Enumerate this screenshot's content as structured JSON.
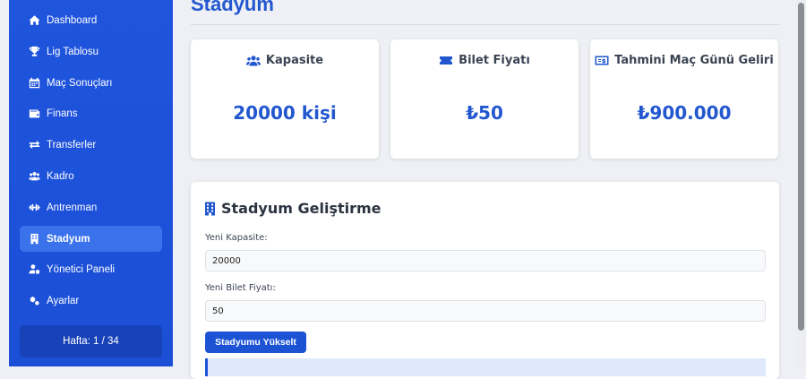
{
  "sidebar": {
    "items": [
      {
        "label": "Dashboard",
        "icon": "home-icon"
      },
      {
        "label": "Lig Tablosu",
        "icon": "trophy-icon"
      },
      {
        "label": "Maç Sonuçları",
        "icon": "calendar-icon"
      },
      {
        "label": "Finans",
        "icon": "wallet-icon"
      },
      {
        "label": "Transferler",
        "icon": "exchange-icon"
      },
      {
        "label": "Kadro",
        "icon": "users-icon"
      },
      {
        "label": "Antrenman",
        "icon": "dumbbell-icon"
      },
      {
        "label": "Stadyum",
        "icon": "building-icon",
        "active": true
      },
      {
        "label": "Yönetici Paneli",
        "icon": "user-cog-icon"
      },
      {
        "label": "Ayarlar",
        "icon": "gears-icon"
      }
    ],
    "week": "Hafta: 1 / 34"
  },
  "page": {
    "title": "Stadyum"
  },
  "cards": [
    {
      "title": "Kapasite",
      "value": "20000 kişi",
      "icon": "users-icon"
    },
    {
      "title": "Bilet Fiyatı",
      "value": "₺50",
      "icon": "ticket-icon"
    },
    {
      "title": "Tahmini Maç Günü Geliri",
      "value": "₺900.000",
      "icon": "money-bill-icon"
    }
  ],
  "upgrade": {
    "title": "Stadyum Geliştirme",
    "icon": "building-icon",
    "capacity_label": "Yeni Kapasite:",
    "capacity_value": "20000",
    "price_label": "Yeni Bilet Fiyatı:",
    "price_value": "50",
    "button_label": "Stadyumu Yükselt"
  },
  "colors": {
    "sidebar": "#1f54dd",
    "accent": "#2257cf",
    "background": "#eef0f5"
  }
}
